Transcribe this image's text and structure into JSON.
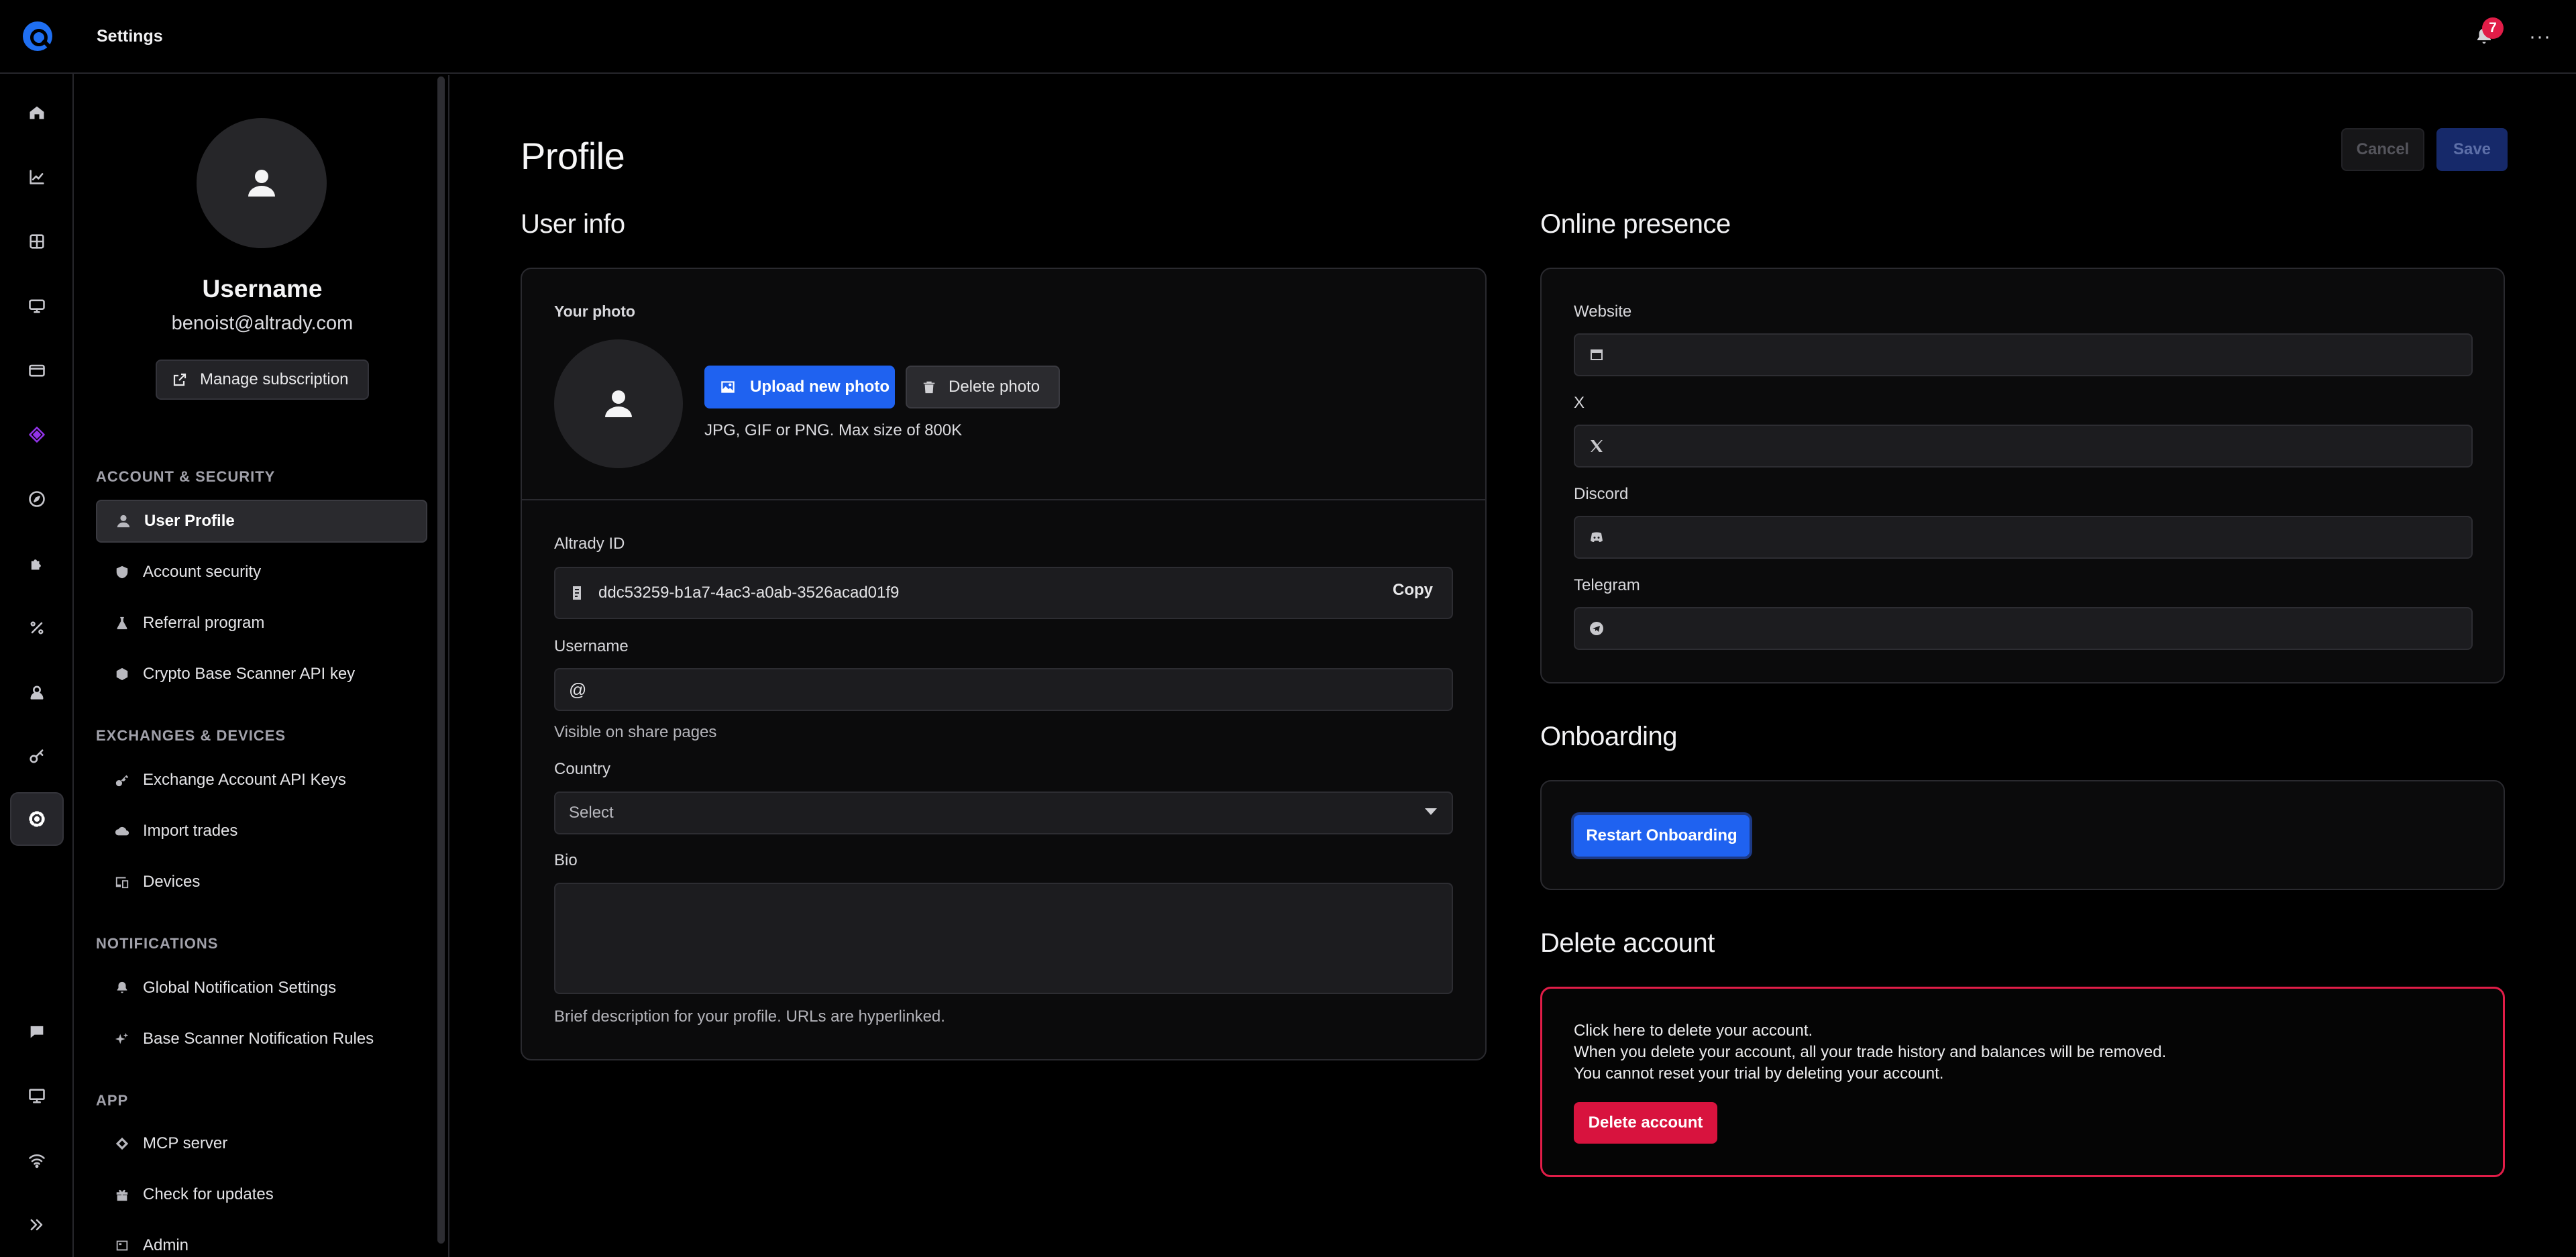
{
  "topbar": {
    "title": "Settings",
    "notification_count": "7"
  },
  "rail": {
    "icons": [
      "home-icon",
      "chart-icon",
      "grid-icon",
      "monitor-icon",
      "wallet-icon",
      "diamond-icon",
      "compass-icon",
      "puzzle-icon",
      "percent-icon",
      "user-badge-icon",
      "key-icon",
      "gear-icon",
      "chat-icon",
      "desktop-icon",
      "wifi-icon",
      "expand-icon"
    ],
    "active": "gear-icon",
    "accent": "#9333ea"
  },
  "sidebar": {
    "username": "Username",
    "email": "benoist@altrady.com",
    "manage_subscription": "Manage subscription",
    "sections": [
      {
        "label": "ACCOUNT & SECURITY",
        "items": [
          "User Profile",
          "Account security",
          "Referral program",
          "Crypto Base Scanner API key"
        ]
      },
      {
        "label": "EXCHANGES & DEVICES",
        "items": [
          "Exchange Account API Keys",
          "Import trades",
          "Devices"
        ]
      },
      {
        "label": "NOTIFICATIONS",
        "items": [
          "Global Notification Settings",
          "Base Scanner Notification Rules"
        ]
      },
      {
        "label": "APP",
        "items": [
          "MCP server",
          "Check for updates",
          "Admin"
        ]
      }
    ],
    "active_item": "User Profile"
  },
  "header": {
    "title": "Profile",
    "cancel": "Cancel",
    "save": "Save"
  },
  "user_info": {
    "title": "User info",
    "photo_label": "Your photo",
    "upload_button": "Upload new photo",
    "delete_button": "Delete photo",
    "photo_hint": "JPG, GIF or PNG. Max size of 800K",
    "altrady_id_label": "Altrady ID",
    "altrady_id_value": "ddc53259-b1a7-4ac3-a0ab-3526acad01f9",
    "copy": "Copy",
    "username_label": "Username",
    "username_prefix": "@",
    "username_value": "",
    "username_hint": "Visible on share pages",
    "country_label": "Country",
    "country_value": "Select",
    "bio_label": "Bio",
    "bio_value": "",
    "bio_hint": "Brief description for your profile. URLs are hyperlinked."
  },
  "online_presence": {
    "title": "Online presence",
    "fields": [
      {
        "label": "Website",
        "icon": "browser-icon",
        "value": ""
      },
      {
        "label": "X",
        "icon": "x-logo-icon",
        "value": ""
      },
      {
        "label": "Discord",
        "icon": "discord-icon",
        "value": ""
      },
      {
        "label": "Telegram",
        "icon": "telegram-icon",
        "value": ""
      }
    ]
  },
  "onboarding": {
    "title": "Onboarding",
    "restart_button": "Restart Onboarding"
  },
  "delete_account": {
    "title": "Delete account",
    "lines": [
      "Click here to delete your account.",
      "When you delete your account, all your trade history and balances will be removed.",
      "You cannot reset your trial by deleting your account."
    ],
    "button": "Delete account",
    "danger_color": "#e11d48"
  }
}
